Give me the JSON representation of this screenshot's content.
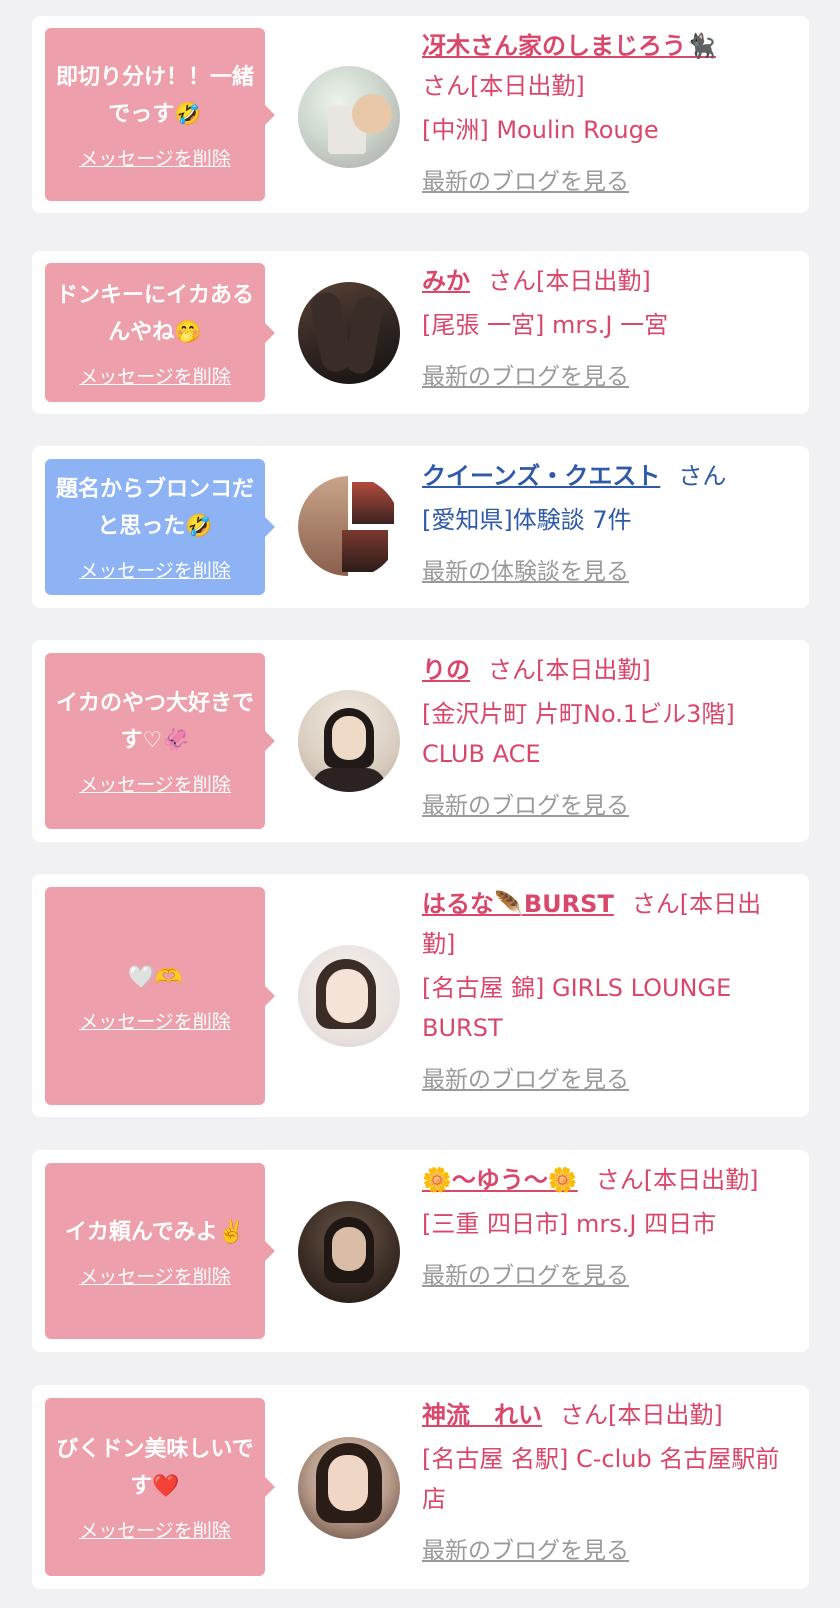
{
  "colors": {
    "page_bg": "#f1f1f3",
    "card_bg": "#ffffff",
    "pink_bubble": "#eda0ac",
    "blue_bubble": "#8db3f5",
    "pink_text": "#d9476b",
    "blue_text": "#2f5aa8",
    "link_gray": "#9a9a9a"
  },
  "cards": [
    {
      "message": "即切り分け！！一緒でっす🤣",
      "delete_label": "メッセージを削除",
      "name": "冴木さん家のしまじろう",
      "name_icon": "🐈‍⬛",
      "suffix": "さん[本日出勤]",
      "shop": "[中洲] Moulin Rouge",
      "link": "最新のブログを見る"
    },
    {
      "message": "ドンキーにイカあるんやね🤭",
      "delete_label": "メッセージを削除",
      "name": "みか",
      "suffix": "さん[本日出勤]",
      "shop": "[尾張 一宮] mrs.J 一宮",
      "link": "最新のブログを見る"
    },
    {
      "message": "題名からブロンコだと思った🤣",
      "delete_label": "メッセージを削除",
      "name": "クイーンズ・クエスト",
      "suffix": "さん",
      "shop": "[愛知県]体験談 7件",
      "link": "最新の体験談を見る"
    },
    {
      "message": "イカのやつ大好きです♡🦑",
      "delete_label": "メッセージを削除",
      "name": "りの",
      "suffix": "さん[本日出勤]",
      "shop": "[金沢片町 片町No.1ビル3階] CLUB ACE",
      "link": "最新のブログを見る"
    },
    {
      "message": "🤍🫶",
      "delete_label": "メッセージを削除",
      "name": "はるな",
      "name_icon": "🪶",
      "name_suffix": "BURST",
      "suffix": "さん[本日出勤]",
      "shop": "[名古屋 錦] GIRLS LOUNGE BURST",
      "link": "最新のブログを見る"
    },
    {
      "message": "イカ頼んでみよ✌️",
      "delete_label": "メッセージを削除",
      "name": "〜ゆう〜",
      "name_icon": "🌼",
      "suffix": "さん[本日出勤]",
      "shop": "[三重 四日市] mrs.J 四日市",
      "link": "最新のブログを見る"
    },
    {
      "message": "びくドン美味しいです❤️",
      "delete_label": "メッセージを削除",
      "name": "神流　れい",
      "suffix": "さん[本日出勤]",
      "shop": "[名古屋 名駅] C-club 名古屋駅前店",
      "link": "最新のブログを見る"
    }
  ]
}
